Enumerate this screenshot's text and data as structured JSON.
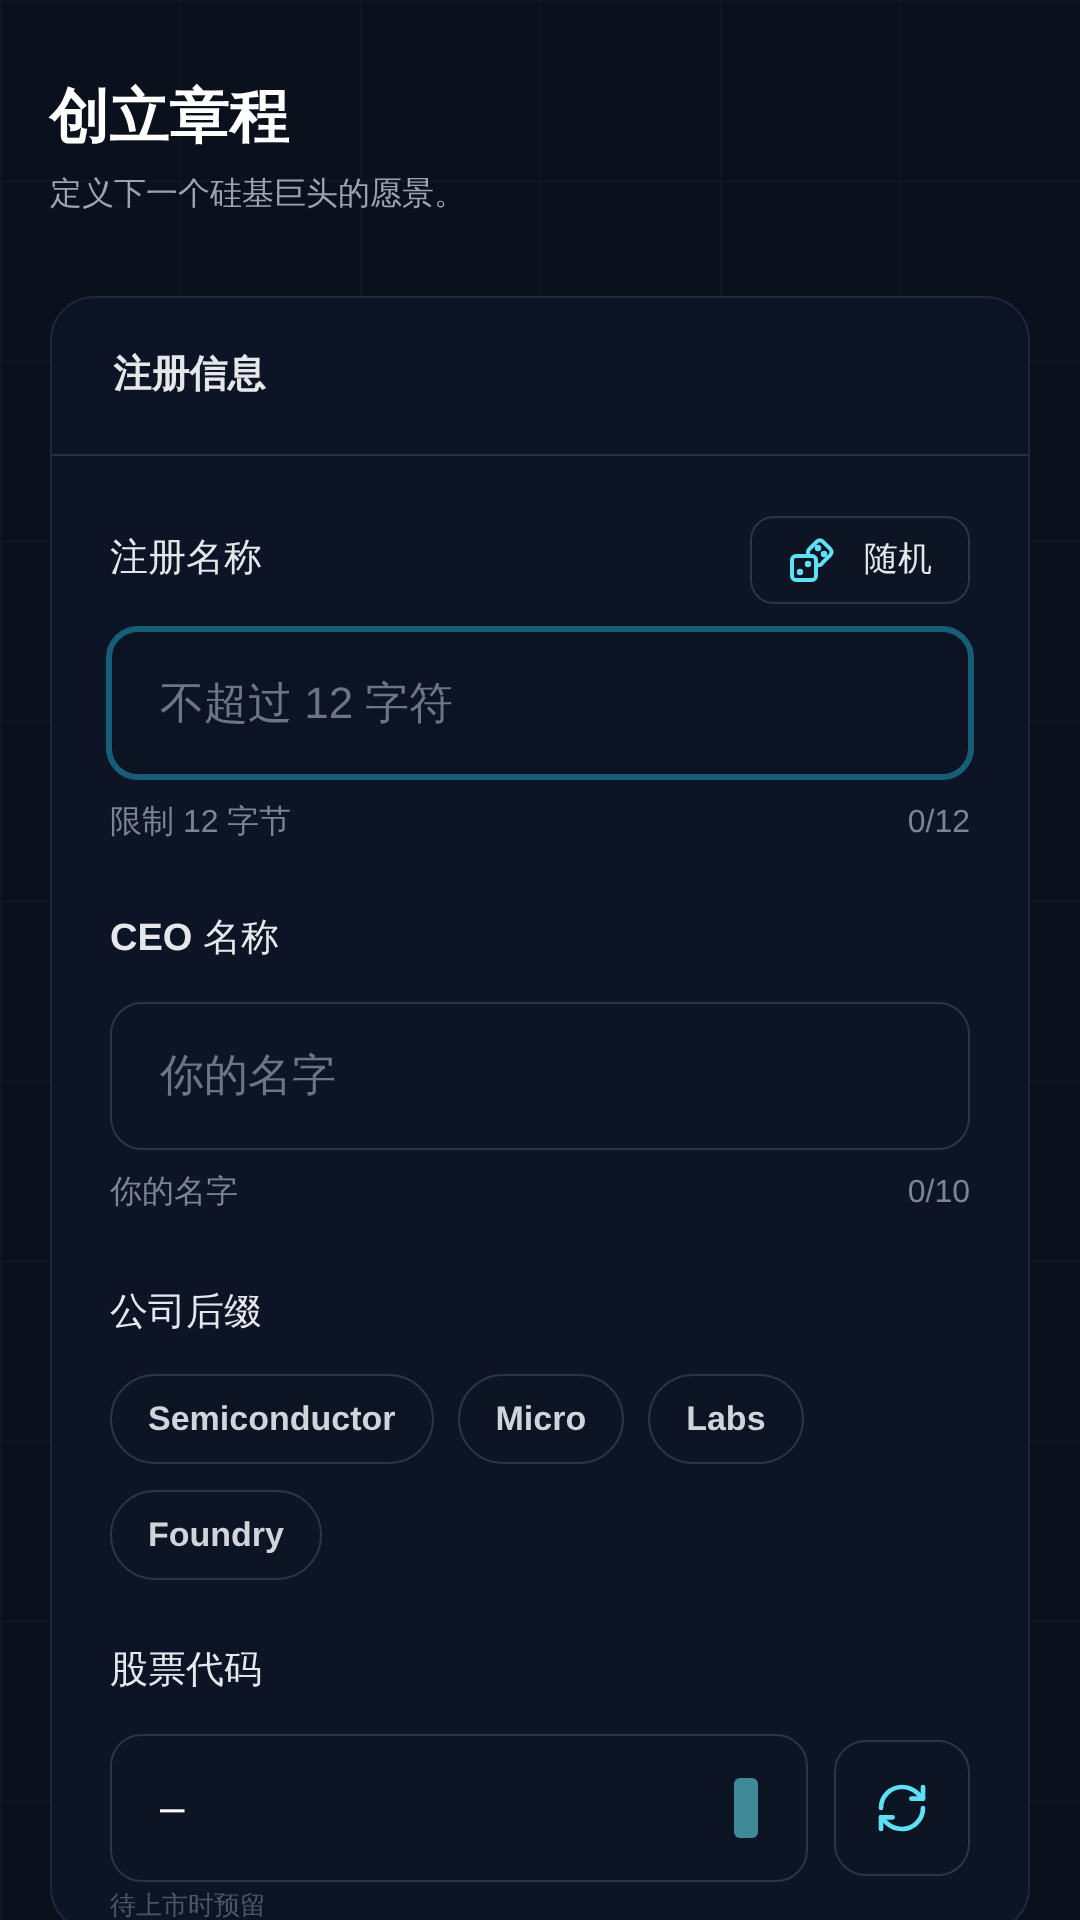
{
  "header": {
    "title": "创立章程",
    "subtitle": "定义下一个硅基巨头的愿景。"
  },
  "card": {
    "title": "注册信息",
    "name_field": {
      "label": "注册名称",
      "random_button": "随机",
      "placeholder": "不超过 12 字符",
      "focused": true,
      "hint": "限制 12 字节",
      "count": "0/12"
    },
    "ceo_field": {
      "label_bold": "CEO",
      "label": "名称",
      "placeholder": "你的名字",
      "focused": false,
      "hint": "你的名字",
      "count": "0/10"
    },
    "suffix": {
      "label": "公司后缀",
      "chips": [
        {
          "label": "Semiconductor"
        },
        {
          "label": "Micro"
        },
        {
          "label": "Labs"
        },
        {
          "label": "Foundry"
        }
      ]
    },
    "ticker": {
      "label": "股票代码",
      "value": "–",
      "hint": "待上市时预留"
    }
  }
}
